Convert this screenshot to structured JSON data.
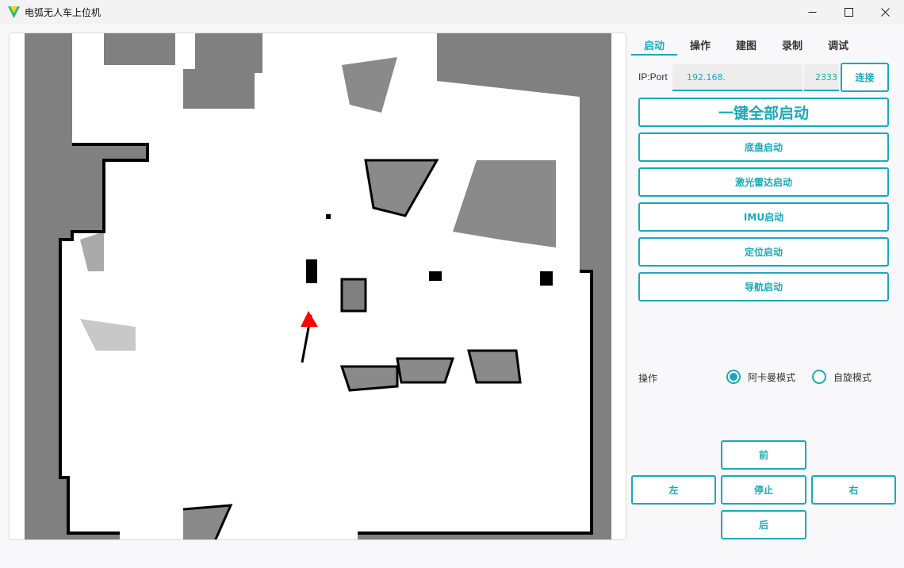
{
  "window": {
    "title": "电弧无人车上位机",
    "controls": {
      "minimize": "minimize-icon",
      "maximize": "maximize-icon",
      "close": "close-icon"
    }
  },
  "tabs": [
    {
      "label": "启动",
      "active": true
    },
    {
      "label": "操作",
      "active": false
    },
    {
      "label": "建图",
      "active": false
    },
    {
      "label": "录制",
      "active": false
    },
    {
      "label": "调试",
      "active": false
    }
  ],
  "connection": {
    "label": "IP:Port",
    "ip_value": "192.168.",
    "port_value": "2333",
    "connect_button": "连接"
  },
  "launch": {
    "all": "一键全部启动",
    "chassis": "底盘启动",
    "lidar": "激光雷达启动",
    "imu": "IMU启动",
    "localization": "定位启动",
    "navigation": "导航启动"
  },
  "operation": {
    "label": "操作",
    "modes": [
      {
        "label": "阿卡曼模式",
        "selected": true
      },
      {
        "label": "自旋模式",
        "selected": false
      }
    ]
  },
  "drive": {
    "forward": "前",
    "left": "左",
    "stop": "停止",
    "right": "右",
    "back": "后"
  },
  "colors": {
    "accent": "#1aa9b8",
    "map_unknown": "#808080",
    "map_free": "#ffffff",
    "map_wall": "#000000",
    "goal_arrow": "#ff0000"
  }
}
